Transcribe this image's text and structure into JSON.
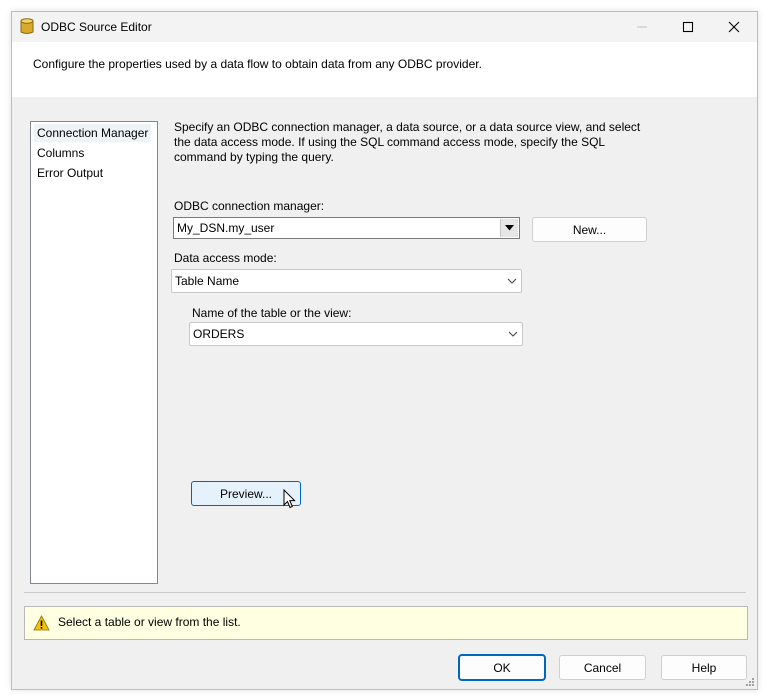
{
  "window": {
    "title": "ODBC Source Editor",
    "icon": "database-cylinder-icon"
  },
  "header": {
    "text": "Configure the properties used by a data flow to obtain data from any ODBC provider."
  },
  "nav": {
    "items": [
      {
        "label": "Connection Manager",
        "selected": true
      },
      {
        "label": "Columns",
        "selected": false
      },
      {
        "label": "Error Output",
        "selected": false
      }
    ]
  },
  "main": {
    "description": "Specify an ODBC connection manager, a data source, or a data source view, and select the data access mode. If using the SQL command access mode, specify the SQL command by typing the query.",
    "connection_label": "ODBC connection manager:",
    "connection_value": "My_DSN.my_user",
    "new_button": "New...",
    "access_mode_label": "Data access mode:",
    "access_mode_value": "Table Name",
    "table_label": "Name of the table or the view:",
    "table_value": "ORDERS",
    "preview_button": "Preview..."
  },
  "status": {
    "icon": "warning-icon",
    "text": "Select a table or view from the list."
  },
  "footer": {
    "ok": "OK",
    "cancel": "Cancel",
    "help": "Help"
  },
  "colors": {
    "status_bg": "#ffffe1",
    "focus_border": "#0067c0",
    "preview_bg": "#e5f1fb"
  }
}
